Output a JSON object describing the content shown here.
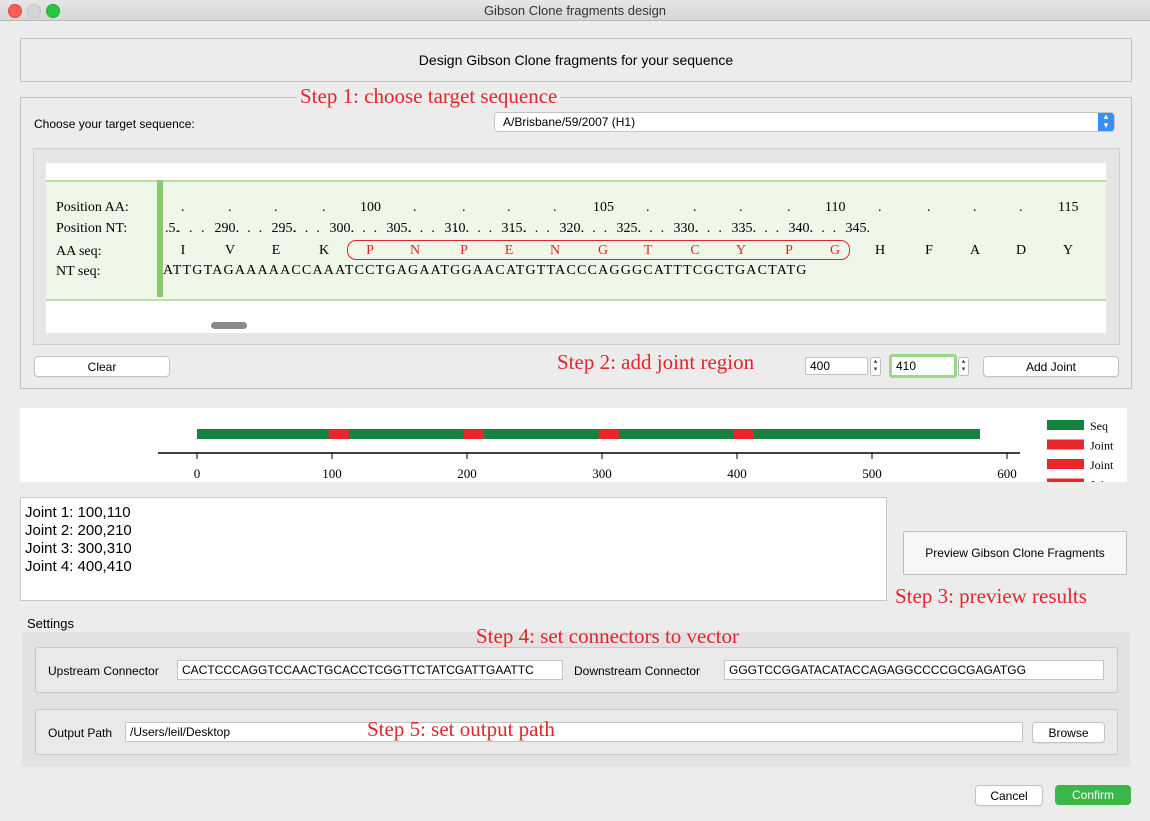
{
  "window": {
    "title": "Gibson Clone fragments design"
  },
  "header": {
    "text": "Design Gibson Clone fragments for your sequence"
  },
  "steps": {
    "step1": "Step 1: choose target sequence",
    "step2": "Step 2: add joint region",
    "step3": "Step 3: preview results",
    "step4": "Step 4: set connectors to vector",
    "step5": "Step 5: set output path"
  },
  "target": {
    "label": "Choose your target sequence:",
    "selected": "A/Brisbane/59/2007 (H1)"
  },
  "sequence_view": {
    "row_labels": [
      "Position AA:",
      "Position NT:",
      "AA seq:",
      "NT seq:"
    ],
    "aa_positions": [
      "100",
      "105",
      "110",
      "115"
    ],
    "nt_positions": [
      "5.",
      "290.",
      "295.",
      "300.",
      "305.",
      "310.",
      "315.",
      "320.",
      "325.",
      "330.",
      "335.",
      "340.",
      "345."
    ],
    "aa_seq": [
      "I",
      "V",
      "E",
      "K",
      "P",
      "N",
      "P",
      "E",
      "N",
      "G",
      "T",
      "C",
      "Y",
      "P",
      "G",
      "H",
      "F",
      "A",
      "D",
      "Y"
    ],
    "aa_highlight_range": [
      4,
      14
    ],
    "nt_seq": "ATTGTAGAAAAACCAAATCCTGAGAATGGAACATGTTACCCAGGGCATTTCGCTGACTATG"
  },
  "joint_controls": {
    "clear_label": "Clear",
    "start": "400",
    "end": "410",
    "add_label": "Add Joint"
  },
  "chart_data": {
    "type": "bar",
    "xlim": [
      0,
      600
    ],
    "ticks": [
      0,
      100,
      200,
      300,
      400,
      500,
      600
    ],
    "sequence_span": [
      0,
      580
    ],
    "joints": [
      [
        100,
        110
      ],
      [
        200,
        210
      ],
      [
        300,
        310
      ],
      [
        400,
        410
      ]
    ],
    "legend": [
      "Seq",
      "Joint",
      "Joint",
      "Joint"
    ],
    "colors": {
      "seq": "#138440",
      "joint": "#e8262b"
    }
  },
  "joints_list": [
    "Joint 1: 100,110",
    "Joint 2: 200,210",
    "Joint 3: 300,310",
    "Joint 4: 400,410"
  ],
  "preview": {
    "label": "Preview Gibson Clone Fragments"
  },
  "settings": {
    "label": "Settings",
    "upstream_label": "Upstream Connector",
    "upstream_value": "CACTCCCAGGTCCAACTGCACCTCGGTTCTATCGATTGAATTC",
    "downstream_label": "Downstream Connector",
    "downstream_value": "GGGTCCGGATACATACCAGAGGCCCCGCGAGATGG",
    "output_label": "Output Path",
    "output_value": "/Users/leil/Desktop",
    "browse_label": "Browse"
  },
  "footer": {
    "cancel": "Cancel",
    "confirm": "Confirm"
  },
  "colors": {
    "accent_green": "#3cb54a",
    "step_red": "#e0262a"
  }
}
